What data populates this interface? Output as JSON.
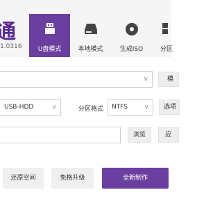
{
  "app": {
    "logo_text": "通",
    "version": "1.0316"
  },
  "tabs": [
    {
      "label": "U盘模式",
      "icon": "usb-drive-icon",
      "active": true
    },
    {
      "label": "本地模式",
      "icon": "hard-disk-icon",
      "active": false
    },
    {
      "label": "生成ISO",
      "icon": "disc-icon",
      "active": false
    },
    {
      "label": "分区",
      "icon": "partition-grid-icon",
      "active": false
    }
  ],
  "device_row": {
    "select_value": "",
    "button_label": "模"
  },
  "mode_row": {
    "boot_mode_value": "USB-HDD",
    "partition_format_label": "分区格式",
    "partition_format_value": "NTFS",
    "options_button_label": "选项"
  },
  "path_row": {
    "path_value": "",
    "browse_label": "浏览",
    "apply_label": "应"
  },
  "actions": {
    "restore_label": "还原空间",
    "upgrade_label": "免格升级",
    "create_label": "全新制作"
  },
  "colors": {
    "accent": "#6b3fa0",
    "header_bg": "#f5f5f5"
  }
}
